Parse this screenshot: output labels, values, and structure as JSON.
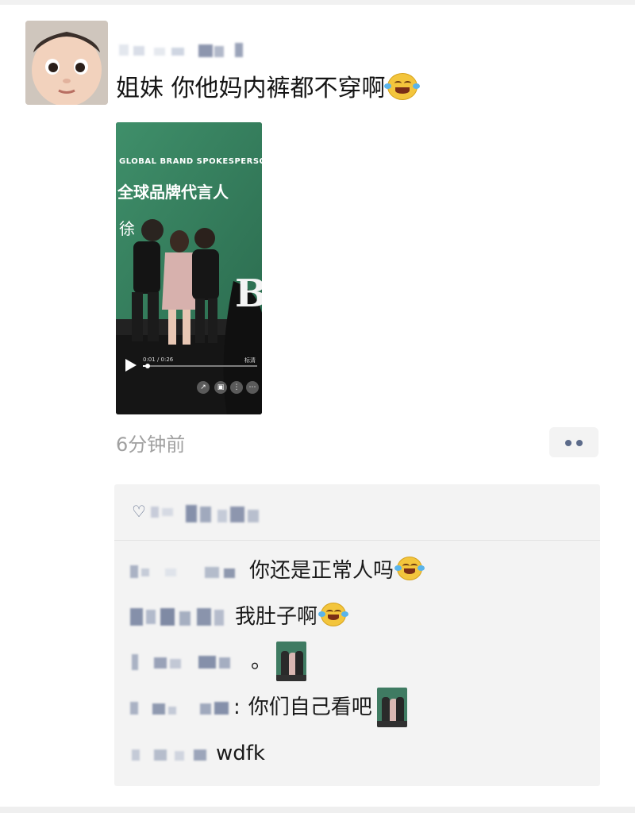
{
  "post": {
    "text": "姐妹 你他妈内裤都不穿啊",
    "emoji": "tears-of-joy-emoji",
    "timestamp": "6分钟前"
  },
  "video": {
    "banner": "GLOBAL BRAND SPOKESPERSON",
    "title": "全球品牌代言人",
    "name": "徐",
    "logo": "B",
    "time": "0:01 / 0:26",
    "quality": "标清",
    "progress": 0.04
  },
  "comments": [
    {
      "text": "你还是正常人吗",
      "emoji": "laughing-emoji"
    },
    {
      "text": "我肚子啊",
      "emoji": "laughing-emoji"
    },
    {
      "text": "。",
      "thumbnail": "video-thumbnail"
    },
    {
      "text": "你们自己看吧",
      "colon": ":",
      "thumbnail": "video-thumbnail"
    },
    {
      "text": "wdfk"
    }
  ],
  "colors": {
    "link": "#5c6b8a",
    "timestamp": "#a0a0a0",
    "comment_bg": "#f3f3f3",
    "video_green": "#3f7b62"
  }
}
